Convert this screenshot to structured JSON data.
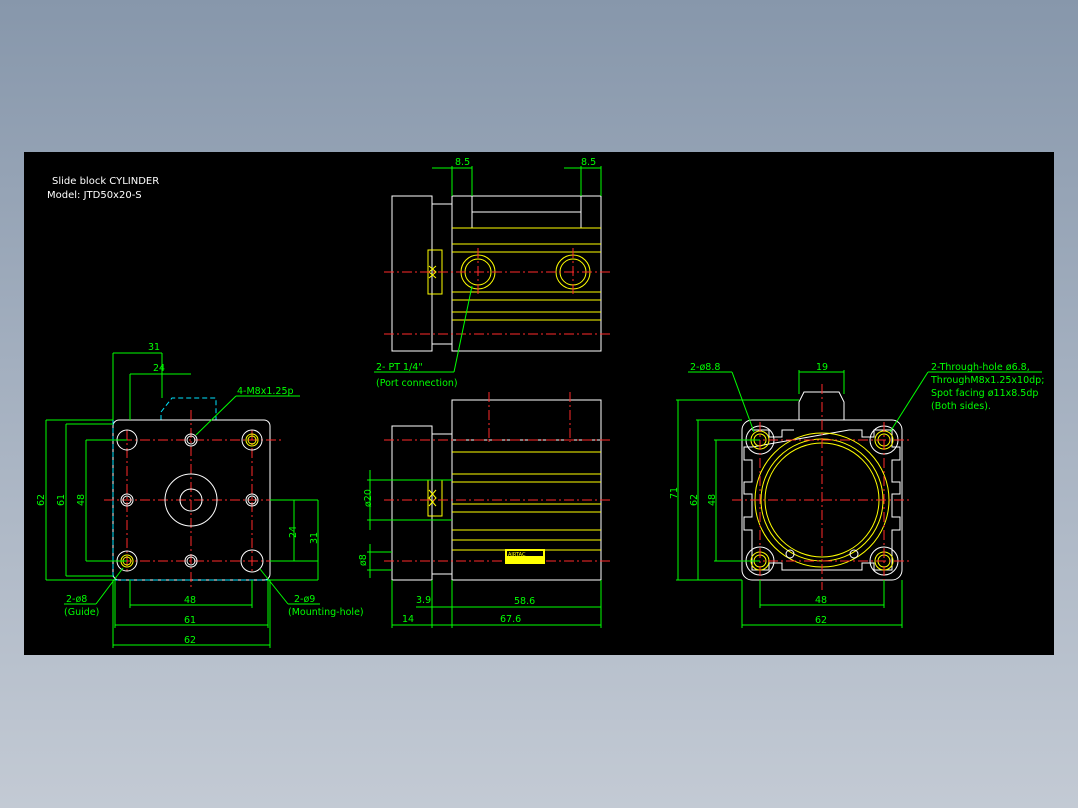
{
  "title": {
    "line1": "Slide block CYLINDER",
    "line2": "Model: JTD50x20-S"
  },
  "left_view": {
    "dim_31": "31",
    "dim_24": "24",
    "dim_62_v": "62",
    "dim_61_v": "61",
    "dim_48_v": "48",
    "dim_24_v": "24",
    "dim_31_v": "31",
    "dim_48_h": "48",
    "dim_61_h": "61",
    "dim_62_h": "62",
    "callout_m8": "4-M8x1.25p",
    "callout_guide": "2-ø8",
    "callout_guide_note": "(Guide)",
    "callout_mount": "2-ø9",
    "callout_mount_note": "(Mounting-hole)"
  },
  "top_view": {
    "dim_85_left": "8.5",
    "dim_85_right": "8.5",
    "callout_port": "2- PT 1/4\"",
    "callout_port_note": "(Port connection)"
  },
  "side_view": {
    "dim_20": "ø20",
    "dim_8": "ø8",
    "dim_39": "3.9",
    "dim_586": "58.6",
    "dim_14": "14",
    "dim_676": "67.6",
    "label_text": "AIRTAC"
  },
  "right_view": {
    "callout_88": "2-ø8.8",
    "dim_19": "19",
    "callout_through_1": "2-Through-hole ø6.8,",
    "callout_through_2": "ThroughM8x1.25x10dp;",
    "callout_through_3": "Spot facing ø11x8.5dp",
    "callout_through_4": "(Both sides).",
    "dim_71_v": "71",
    "dim_62_v": "62",
    "dim_48_v": "48",
    "dim_48_h": "48",
    "dim_62_h": "62"
  },
  "colors": {
    "background": "#000000",
    "dimension": "#00ff00",
    "outline": "#ffffff",
    "part": "#ffff00",
    "center_line": "#ff2a2a",
    "hidden": "#00e5ff"
  }
}
